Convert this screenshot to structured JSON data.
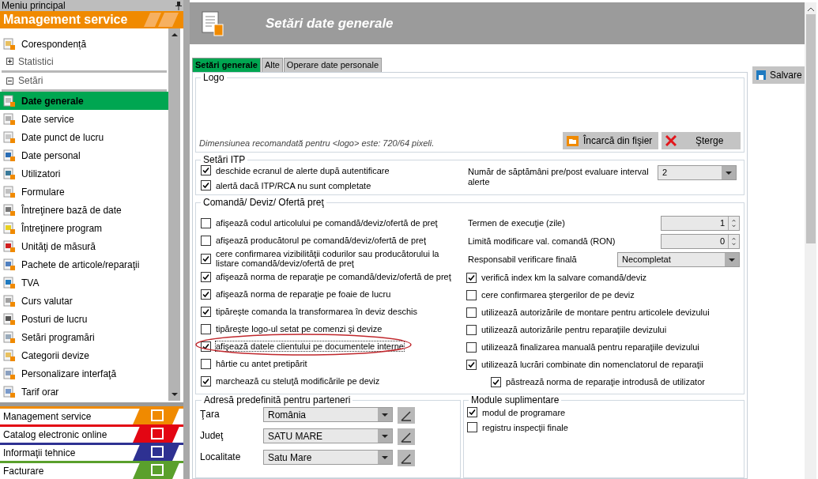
{
  "sidebar": {
    "title": "Meniu principal",
    "module_header": "Management service",
    "items": [
      {
        "kind": "item",
        "label": "Corespondență",
        "selected": false
      },
      {
        "kind": "group",
        "label": "Statistici",
        "expanded": false
      },
      {
        "kind": "group",
        "label": "Setări",
        "expanded": true
      },
      {
        "kind": "item",
        "label": "Date generale",
        "selected": true
      },
      {
        "kind": "item",
        "label": "Date service",
        "selected": false
      },
      {
        "kind": "item",
        "label": "Date punct de lucru",
        "selected": false
      },
      {
        "kind": "item",
        "label": "Date personal",
        "selected": false
      },
      {
        "kind": "item",
        "label": "Utilizatori",
        "selected": false
      },
      {
        "kind": "item",
        "label": "Formulare",
        "selected": false
      },
      {
        "kind": "item",
        "label": "Întreţinere bază de date",
        "selected": false
      },
      {
        "kind": "item",
        "label": "Întreţinere program",
        "selected": false
      },
      {
        "kind": "item",
        "label": "Unităţi de măsură",
        "selected": false
      },
      {
        "kind": "item",
        "label": "Pachete de articole/reparaţii",
        "selected": false
      },
      {
        "kind": "item",
        "label": "TVA",
        "selected": false
      },
      {
        "kind": "item",
        "label": "Curs valutar",
        "selected": false
      },
      {
        "kind": "item",
        "label": "Posturi de lucru",
        "selected": false
      },
      {
        "kind": "item",
        "label": "Setări programări",
        "selected": false
      },
      {
        "kind": "item",
        "label": "Categorii devize",
        "selected": false
      },
      {
        "kind": "item",
        "label": "Personalizare interfaţă",
        "selected": false
      },
      {
        "kind": "item",
        "label": "Tarif orar",
        "selected": false
      }
    ],
    "modules": [
      {
        "label": "Management service",
        "color": "#f08a00"
      },
      {
        "label": "Catalog electronic online",
        "color": "#e30613"
      },
      {
        "label": "Informaţii tehnice",
        "color": "#2e3192"
      },
      {
        "label": "Facturare",
        "color": "#5aa02c"
      }
    ]
  },
  "header": {
    "title": "Setări date generale"
  },
  "tabs": [
    {
      "label": "Setări generale",
      "selected": true
    },
    {
      "label": "Alte",
      "selected": false
    },
    {
      "label": "Operare date personale",
      "selected": false
    }
  ],
  "save_button": "Salvare",
  "logo": {
    "title": "Logo",
    "hint": "Dimensiunea recomandată pentru <logo> este:  720/64 pixeli.",
    "load_button": "Încarcă din fişier",
    "delete_button": "Şterge"
  },
  "itp": {
    "title": "Setări ITP",
    "checkboxes": [
      {
        "label": "deschide ecranul de alerte după autentificare",
        "checked": true
      },
      {
        "label": "alertă dacă ITP/RCA nu sunt completate",
        "checked": true
      }
    ],
    "weeks_label": "Număr de săptămâni pre/post evaluare interval alerte",
    "weeks_value": "2"
  },
  "order": {
    "title": "Comandă/ Deviz/ Ofertă preţ",
    "left": [
      {
        "label": "afişează codul articolului pe comandă/deviz/ofertă de preţ",
        "checked": false,
        "annotated": false
      },
      {
        "label": "afişează producătorul pe comandă/deviz/ofertă de preţ",
        "checked": false,
        "annotated": false
      },
      {
        "label": "cere confirmarea vizibilităţii codurilor sau producătorului la listare comandă/deviz/ofertă de preţ",
        "checked": true,
        "annotated": false
      },
      {
        "label": "afişează norma de reparaţie pe comandă/deviz/ofertă de preţ",
        "checked": true,
        "annotated": false
      },
      {
        "label": "afişează norma de reparaţie pe foaie de lucru",
        "checked": true,
        "annotated": false
      },
      {
        "label": "tipăreşte comanda la transformarea în deviz deschis",
        "checked": true,
        "annotated": false
      },
      {
        "label": "tipăreşte logo-ul setat pe comenzi şi devize",
        "checked": false,
        "annotated": false
      },
      {
        "label": "afişează datele clientului pe documentele interne",
        "checked": true,
        "annotated": true
      },
      {
        "label": "hârtie cu antet pretipărit",
        "checked": false,
        "annotated": false
      },
      {
        "label": "marchează cu steluţă modificările pe deviz",
        "checked": true,
        "annotated": false
      }
    ],
    "fields": [
      {
        "kind": "spin",
        "label": "Termen de execuţie (zile)",
        "value": "1"
      },
      {
        "kind": "spin",
        "label": "Limită modificare val. comandă (RON)",
        "value": "0"
      },
      {
        "kind": "select",
        "label": "Responsabil verificare finală",
        "value": "Necompletat"
      }
    ],
    "right": [
      {
        "label": "verifică index km la salvare comandă/deviz",
        "checked": true
      },
      {
        "label": "cere confirmarea ştergerilor de pe deviz",
        "checked": false
      },
      {
        "label": "utilizează autorizările de montare pentru articolele devizului",
        "checked": false
      },
      {
        "label": "utilizează autorizările pentru reparaţiile devizului",
        "checked": false
      },
      {
        "label": "utilizează finalizarea manuală pentru reparaţiile devizului",
        "checked": false
      },
      {
        "label": "utilizează lucrări combinate din nomenclatorul de reparaţii",
        "checked": true,
        "children": [
          {
            "label": "păstrează norma de reparaţie introdusă de utilizator",
            "checked": true
          }
        ]
      }
    ]
  },
  "address": {
    "title": "Adresă predefinită pentru parteneri",
    "fields": [
      {
        "label": "Ţara",
        "value": "România"
      },
      {
        "label": "Judeţ",
        "value": "SATU MARE"
      },
      {
        "label": "Localitate",
        "value": "Satu Mare"
      }
    ]
  },
  "modules": {
    "title": "Module suplimentare",
    "checkboxes": [
      {
        "label": "modul de programare",
        "checked": true
      },
      {
        "label": "registru inspecţii finale",
        "checked": false
      }
    ]
  }
}
